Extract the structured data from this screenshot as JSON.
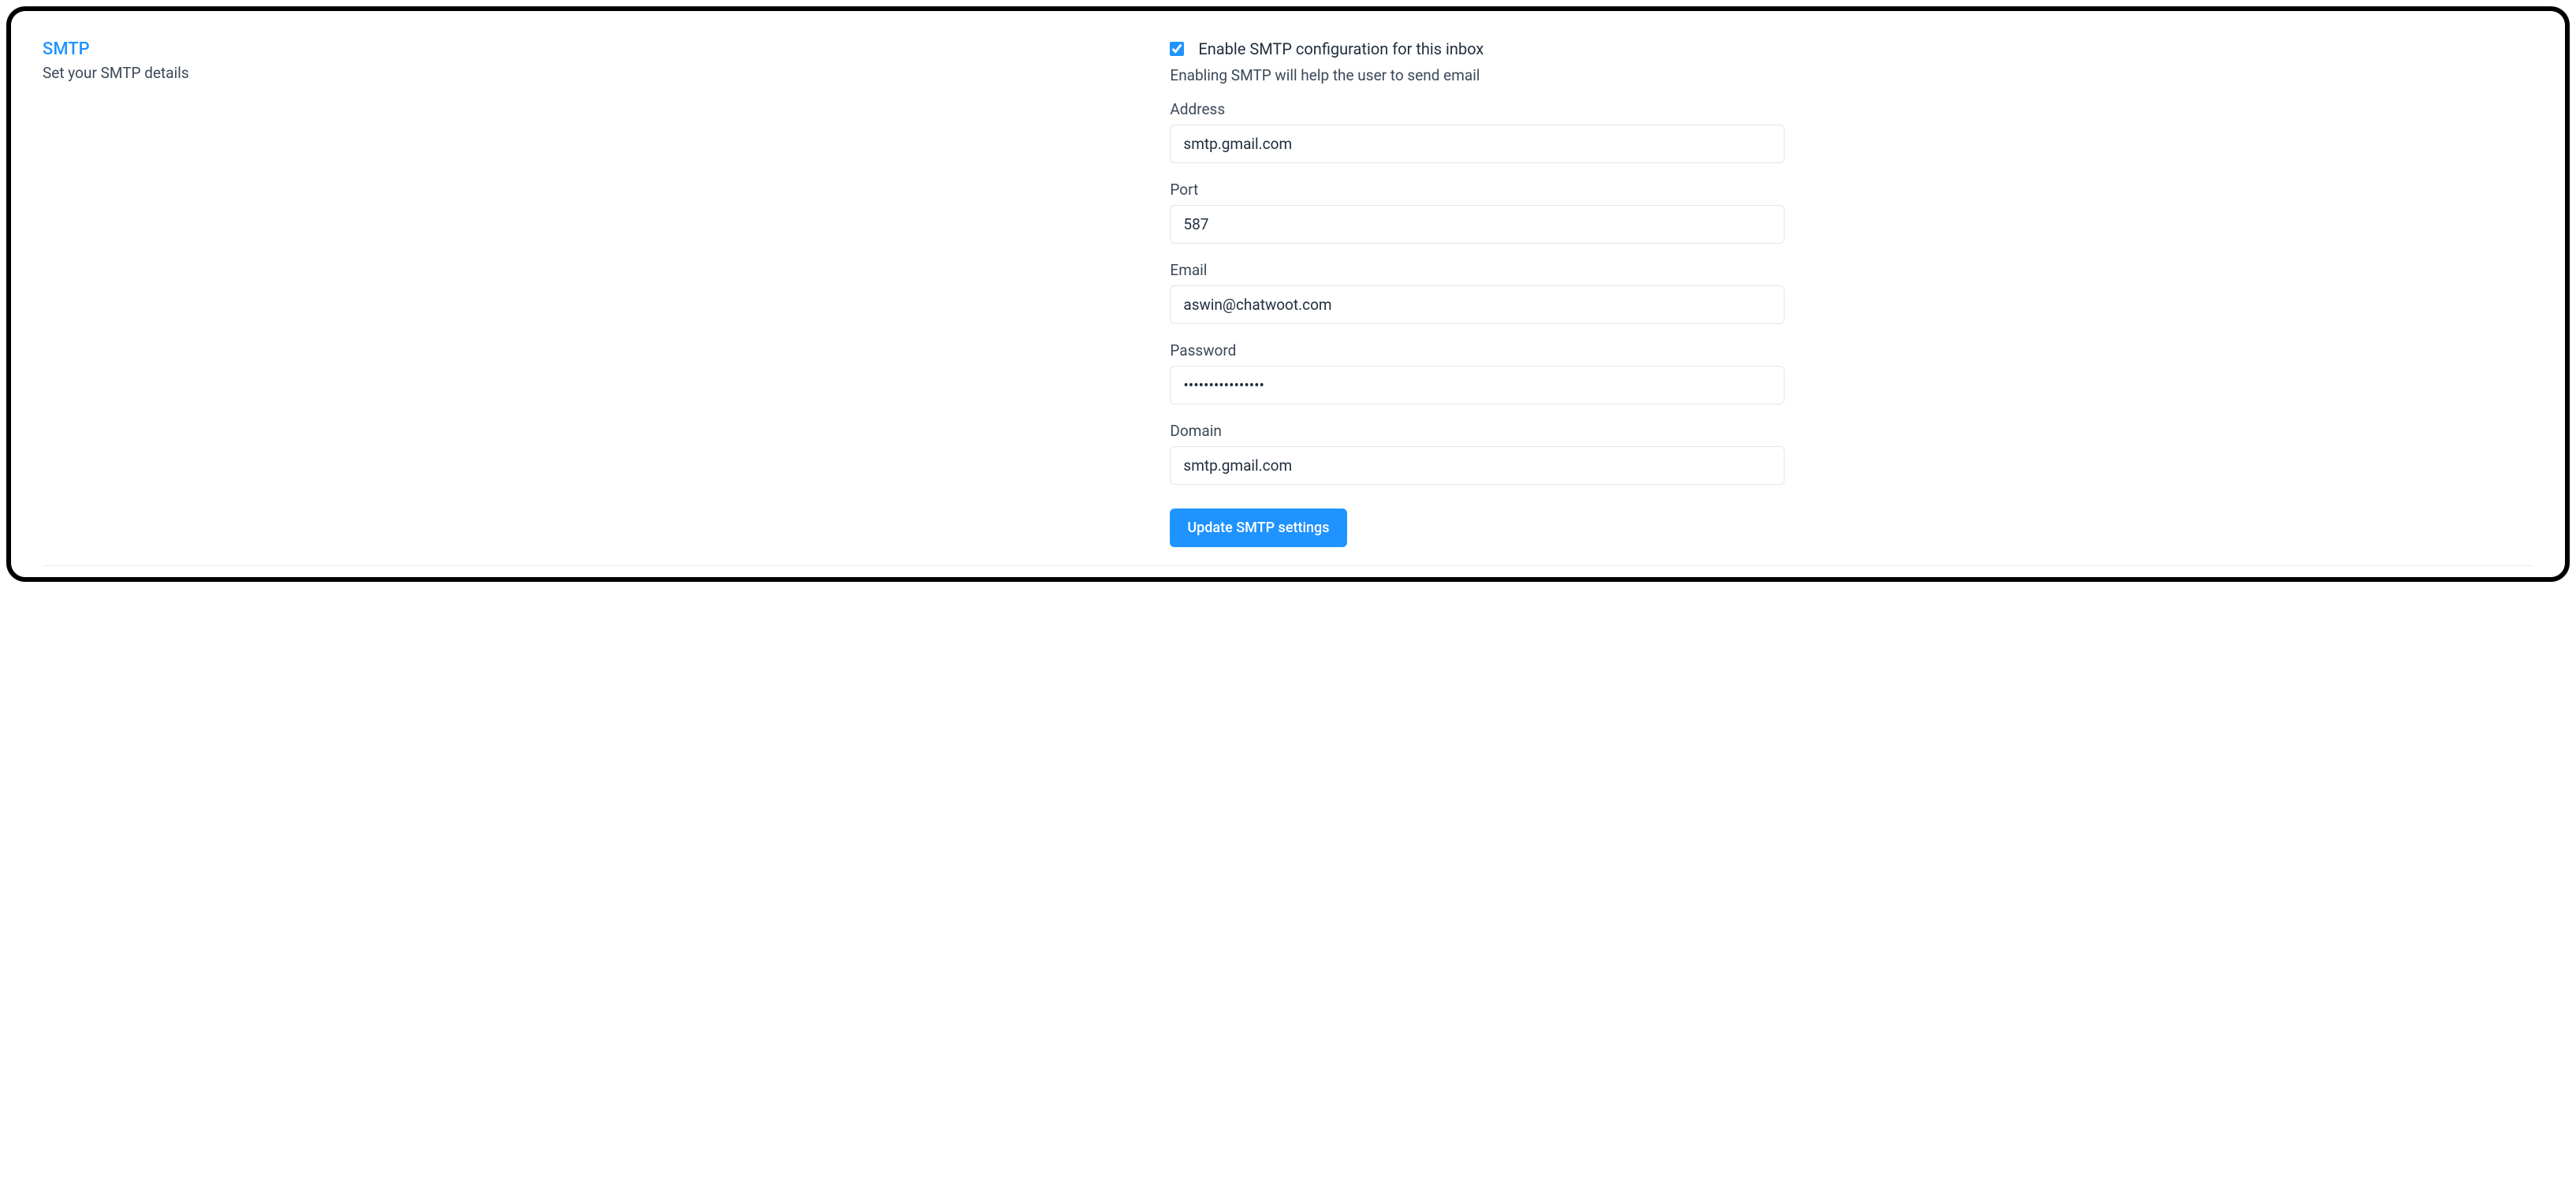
{
  "section": {
    "title": "SMTP",
    "subtitle": "Set your SMTP details"
  },
  "form": {
    "enable": {
      "checked": true,
      "label": "Enable SMTP configuration for this inbox",
      "hint": "Enabling SMTP will help the user to send email"
    },
    "address": {
      "label": "Address",
      "value": "smtp.gmail.com",
      "placeholder": "Address"
    },
    "port": {
      "label": "Port",
      "value": "587",
      "placeholder": "Port"
    },
    "email": {
      "label": "Email",
      "value": "aswin@chatwoot.com",
      "placeholder": "Email"
    },
    "password": {
      "label": "Password",
      "value": "••••••••••••••••",
      "placeholder": "Password"
    },
    "domain": {
      "label": "Domain",
      "value": "smtp.gmail.com",
      "placeholder": "Domain"
    },
    "submit_label": "Update SMTP settings"
  }
}
